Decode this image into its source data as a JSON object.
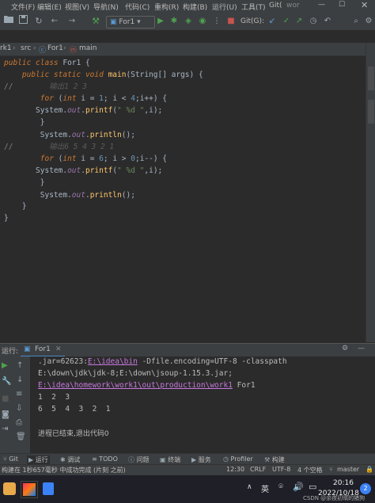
{
  "menubar": {
    "items": [
      "文件(F)",
      "编辑(E)",
      "视图(V)",
      "导航(N)",
      "代码(C)",
      "重构(R)",
      "构建(B)",
      "运行(U)",
      "工具(T)",
      "Git(",
      "wor"
    ]
  },
  "toolbar": {
    "run_config": "For1",
    "git_label": "Git(G):"
  },
  "breadcrumbs": {
    "project": "rk1",
    "src": "src",
    "class": "For1",
    "method": "main"
  },
  "code": {
    "lines": [
      [
        [
          "kw",
          "public class "
        ],
        [
          "",
          "For1 {"
        ]
      ],
      [
        [
          "",
          "    "
        ],
        [
          "kw",
          "public static void "
        ],
        [
          "fn",
          "main"
        ],
        [
          "",
          "(String[] args) {"
        ]
      ],
      [
        [
          "cm",
          "//"
        ],
        [
          "cmi",
          "        输出1 2 3"
        ]
      ],
      [
        [
          "",
          "        "
        ],
        [
          "kw",
          "for "
        ],
        [
          "",
          "("
        ],
        [
          "kw",
          "int "
        ],
        [
          "",
          "i = "
        ],
        [
          "num",
          "1"
        ],
        [
          "",
          "; i < "
        ],
        [
          "num",
          "4"
        ],
        [
          "",
          ";i++) {"
        ]
      ],
      [
        [
          "",
          "       System."
        ],
        [
          "fld",
          "out"
        ],
        [
          "",
          "."
        ],
        [
          "fn",
          "printf"
        ],
        [
          "",
          "("
        ],
        [
          "str",
          "\" %d \""
        ],
        [
          "",
          ",i);"
        ]
      ],
      [
        [
          "",
          "        }"
        ]
      ],
      [
        [
          "",
          "        System."
        ],
        [
          "fld",
          "out"
        ],
        [
          "",
          "."
        ],
        [
          "fn",
          "println"
        ],
        [
          "",
          "();"
        ]
      ],
      [
        [
          "cm",
          "//"
        ],
        [
          "cmi",
          "        输出6 5 4 3 2 1"
        ]
      ],
      [
        [
          "",
          "        "
        ],
        [
          "kw",
          "for "
        ],
        [
          "",
          "("
        ],
        [
          "kw",
          "int "
        ],
        [
          "",
          "i = "
        ],
        [
          "num",
          "6"
        ],
        [
          "",
          "; i > "
        ],
        [
          "num",
          "0"
        ],
        [
          "",
          ";i--) {"
        ]
      ],
      [
        [
          "",
          "       System."
        ],
        [
          "fld",
          "out"
        ],
        [
          "",
          "."
        ],
        [
          "fn",
          "printf"
        ],
        [
          "",
          "("
        ],
        [
          "str",
          "\" %d \""
        ],
        [
          "",
          ",i);"
        ]
      ],
      [
        [
          "",
          "        }"
        ]
      ],
      [
        [
          "",
          "        System."
        ],
        [
          "fld",
          "out"
        ],
        [
          "",
          "."
        ],
        [
          "fn",
          "println"
        ],
        [
          "",
          "();"
        ]
      ],
      [
        [
          "",
          "    }"
        ]
      ],
      [
        [
          "",
          "}"
        ]
      ]
    ]
  },
  "run_panel": {
    "label": "运行:",
    "tab": "For1"
  },
  "console": {
    "line1_a": ".jar=62623:",
    "line1_link": "E:\\idea\\bin",
    "line1_b": " -Dfile.encoding=UTF-8 -classpath",
    "line2": "E:\\down\\jdk\\jdk-8;E:\\down\\jsoup-1.15.3.jar;",
    "line3_link": "E:\\idea\\homework\\work1\\out\\production\\work1",
    "line3_b": " For1",
    "out1": "1  2  3",
    "out2": "6  5  4  3  2  1",
    "exit": "进程已结束,退出代码0"
  },
  "tool_tabs": [
    "Git",
    "运行",
    "调试",
    "TODO",
    "问题",
    "终端",
    "服务",
    "Profiler",
    "构建"
  ],
  "status": {
    "message": "构建在 1秒657毫秒 中成功完成 (片刻 之前)",
    "position": "12:30",
    "line_sep": "CRLF",
    "encoding": "UTF-8",
    "indent": "4 个空格",
    "branch": "master"
  },
  "taskbar": {
    "ime": "英",
    "time": "20:16",
    "date": "2022/10/18",
    "watermark": "CSDN @余夜初晴的猪狗",
    "notif_count": "2"
  },
  "colors": {
    "editor_bg": "#2b2b2b",
    "keyword": "#cc7832",
    "method": "#ffc66d",
    "field": "#9876aa",
    "string": "#6a8759",
    "number": "#6897bb",
    "comment": "#808080"
  }
}
